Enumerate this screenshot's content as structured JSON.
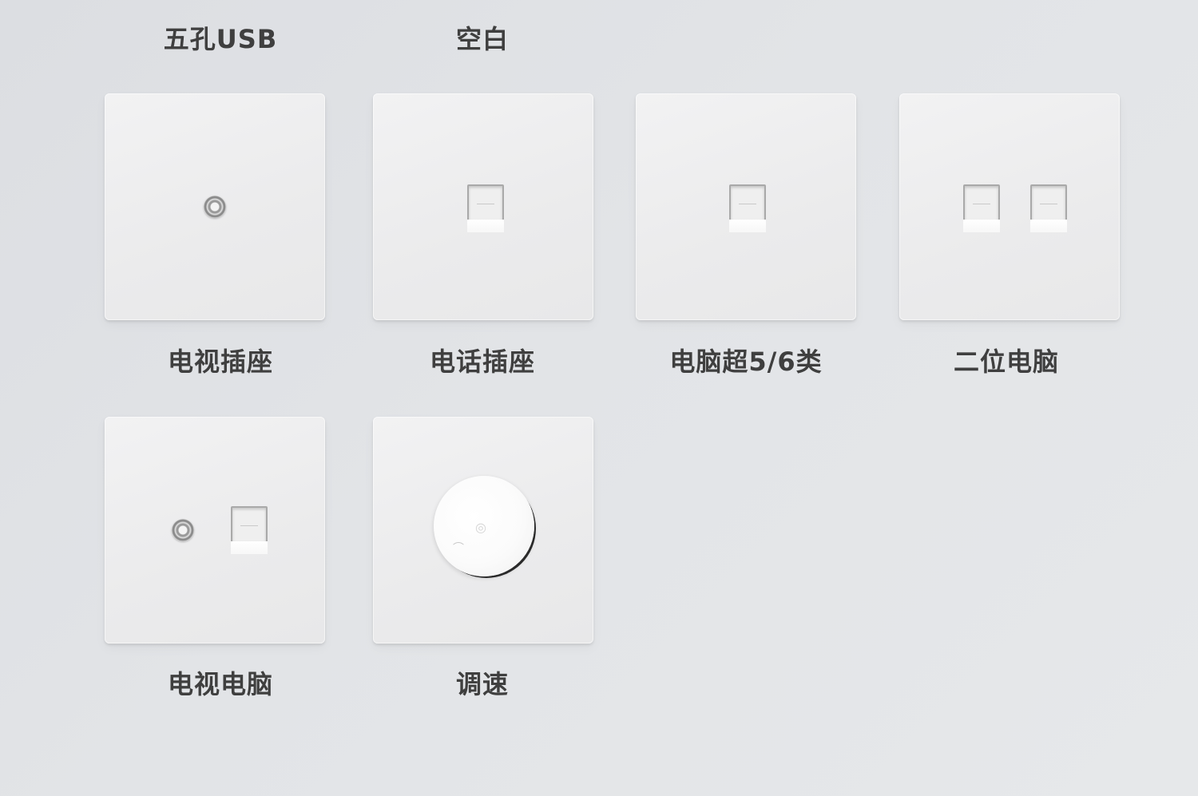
{
  "top_labels": [
    "五孔USB",
    "空白"
  ],
  "panels": [
    {
      "label": "电视插座"
    },
    {
      "label": "电话插座"
    },
    {
      "label": "电脑超5/6类"
    },
    {
      "label": "二位电脑"
    },
    {
      "label": "电视电脑"
    },
    {
      "label": "调速"
    }
  ],
  "colors": {
    "background": "#e0e2e5",
    "panel": "#eeeeef",
    "label_text": "#3f3f3f"
  },
  "icons": [
    "coax-port-icon",
    "rj-port-icon",
    "dimmer-knob-icon"
  ]
}
